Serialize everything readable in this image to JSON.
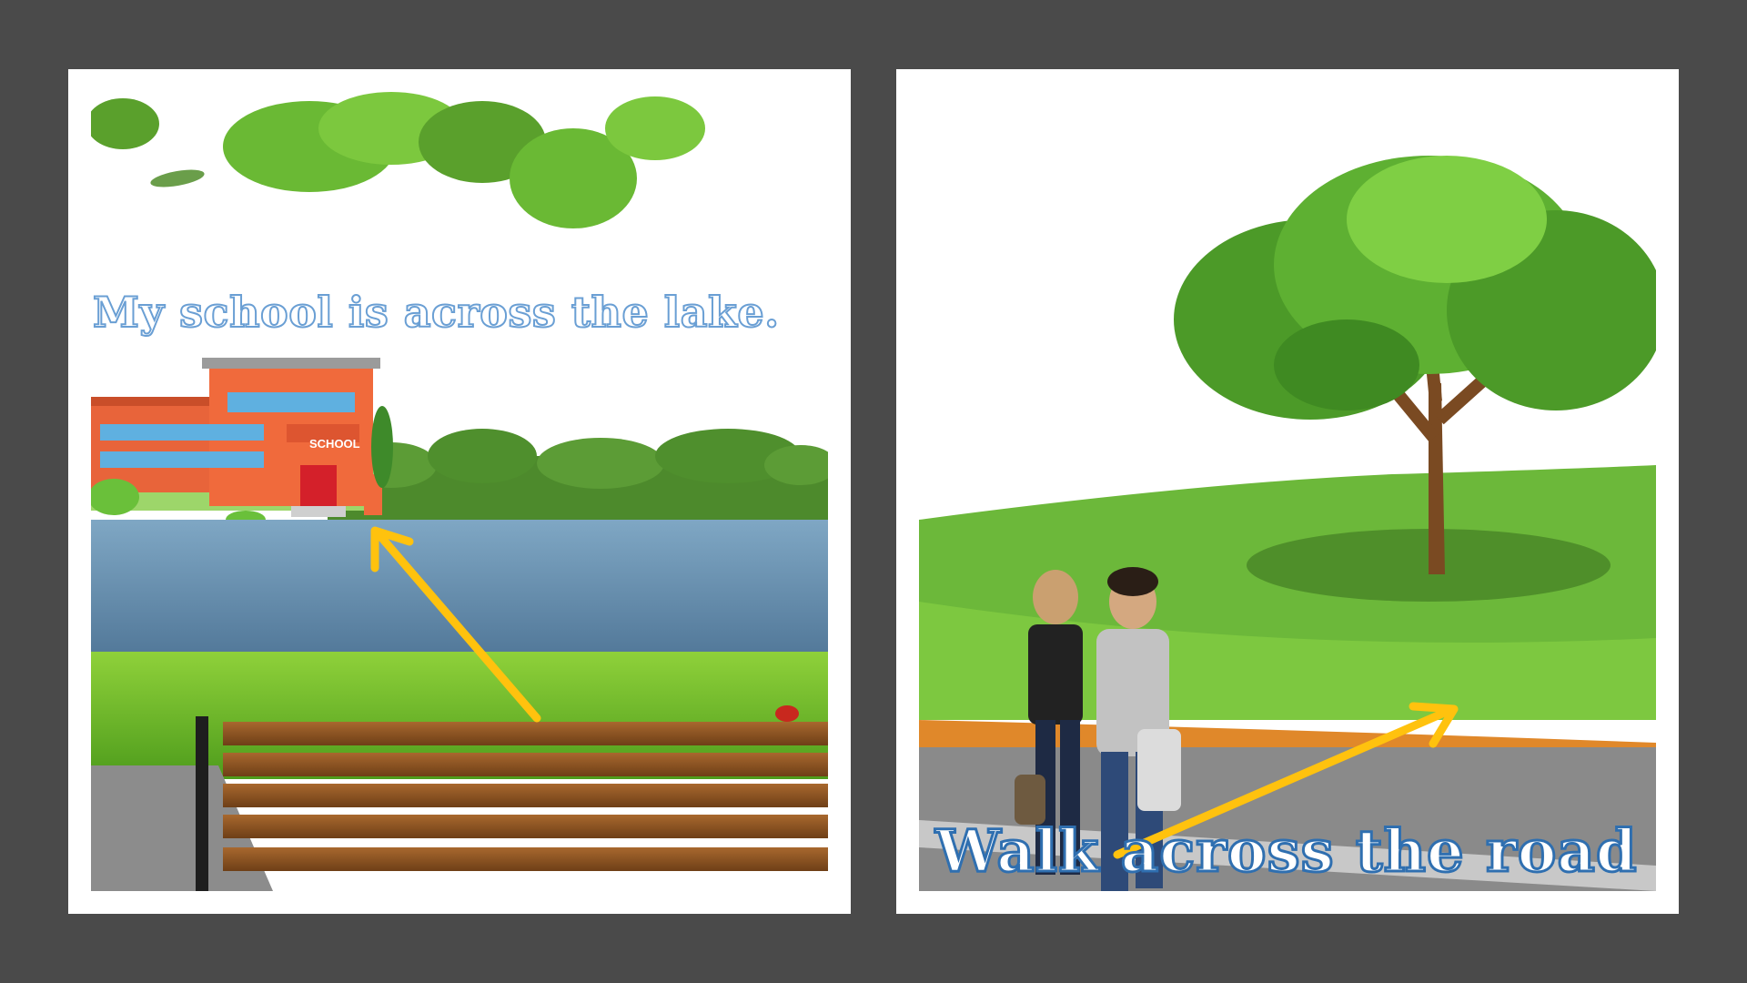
{
  "left_panel": {
    "caption": "My school is across the lake.",
    "school_sign": "SCHOOL"
  },
  "right_panel": {
    "caption": "Walk across the road"
  },
  "colors": {
    "background": "#4a4a4a",
    "card": "#ffffff",
    "arrow": "#ffc20e",
    "caption_left_outline": "#6a9fd4",
    "caption_right_outline": "#2f6fb0"
  }
}
